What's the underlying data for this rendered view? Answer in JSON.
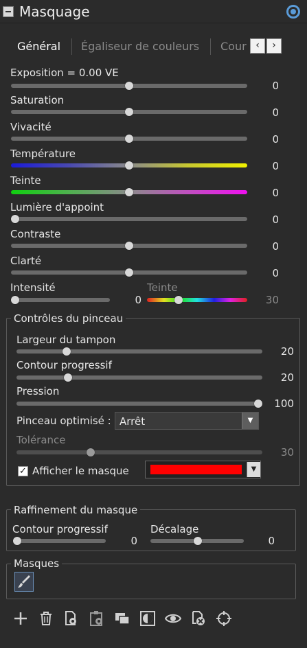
{
  "panel": {
    "title": "Masquage"
  },
  "tabs": [
    {
      "label": "Général",
      "active": true
    },
    {
      "label": "Égaliseur de couleurs",
      "active": false
    },
    {
      "label": "Cour",
      "active": false
    }
  ],
  "nav": {
    "prev": "‹",
    "next": "›"
  },
  "sliders": [
    {
      "label": "Exposition = 0.00 VE",
      "value": "0"
    },
    {
      "label": "Saturation",
      "value": "0"
    },
    {
      "label": "Vivacité",
      "value": "0"
    },
    {
      "label": "Température",
      "value": "0"
    },
    {
      "label": "Teinte",
      "value": "0"
    },
    {
      "label": "Lumière d'appoint",
      "value": "0"
    },
    {
      "label": "Contraste",
      "value": "0"
    },
    {
      "label": "Clarté",
      "value": "0"
    }
  ],
  "intensity": {
    "label": "Intensité",
    "value": "0",
    "hue_label": "Teinte",
    "hue_value": "30"
  },
  "brush": {
    "legend": "Contrôles du pinceau",
    "width": {
      "label": "Largeur du tampon",
      "value": "20"
    },
    "feather": {
      "label": "Contour progressif",
      "value": "20"
    },
    "pressure": {
      "label": "Pression",
      "value": "100"
    },
    "smart_label": "Pinceau optimisé :",
    "smart_value": "Arrêt",
    "tolerance": {
      "label": "Tolérance",
      "value": "30"
    },
    "show_mask_label": "Afficher le masque",
    "show_mask_checked": true,
    "mask_color": "#ff0000"
  },
  "refine": {
    "legend": "Raffinement du masque",
    "feather": {
      "label": "Contour progressif",
      "value": "0"
    },
    "offset": {
      "label": "Décalage",
      "value": "0"
    }
  },
  "masks": {
    "legend": "Masques",
    "selected_icon": "brush-icon"
  },
  "toolbar": [
    "add-icon",
    "trash-icon",
    "copy-mask-icon",
    "paste-mask-icon",
    "overlay-icon",
    "invert-icon",
    "eye-icon",
    "clear-mask-icon",
    "target-icon"
  ],
  "colors": {
    "accent": "#5a9bd8",
    "mask": "#ff0000"
  }
}
